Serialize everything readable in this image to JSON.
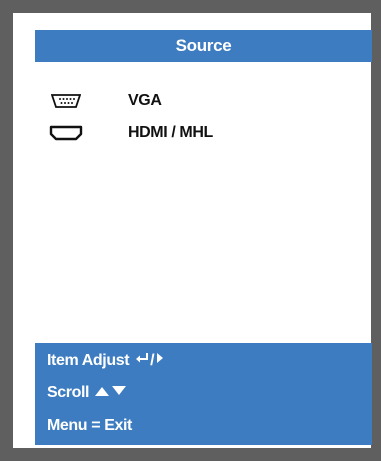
{
  "title": "Source",
  "sources": [
    {
      "label": "VGA",
      "icon": "vga-port-icon"
    },
    {
      "label": "HDMI / MHL",
      "icon": "hdmi-port-icon"
    }
  ],
  "help": {
    "item_adjust": "Item Adjust",
    "item_adjust_icons": [
      "enter-icon",
      "arrow-right-icon"
    ],
    "scroll": "Scroll",
    "scroll_icons": [
      "arrow-up-icon",
      "arrow-down-icon"
    ],
    "menu_exit": "Menu = Exit"
  },
  "colors": {
    "accent": "#3d7cc0",
    "frame": "#5f5f5f",
    "text": "#111111"
  }
}
